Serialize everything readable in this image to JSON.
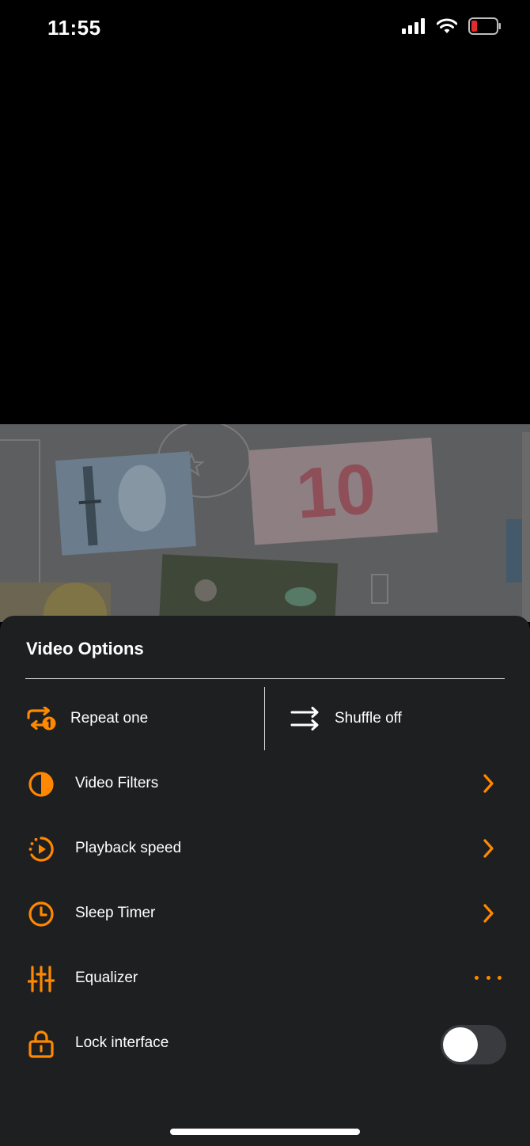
{
  "status_bar": {
    "time": "11:55",
    "icons": [
      "signal-icon",
      "wifi-icon",
      "battery-low-icon"
    ]
  },
  "colors": {
    "accent": "#ff8800",
    "sheet_bg": "#1e1f21",
    "battery_low": "#e32b2b"
  },
  "video": {
    "thumbnail_text": "10"
  },
  "sheet": {
    "title": "Video Options",
    "repeat": {
      "label": "Repeat one",
      "icon": "repeat-one-icon"
    },
    "shuffle": {
      "label": "Shuffle off",
      "icon": "shuffle-icon"
    },
    "items": [
      {
        "label": "Video Filters",
        "icon": "contrast-icon",
        "trailing": "chevron-right-icon"
      },
      {
        "label": "Playback speed",
        "icon": "playback-speed-icon",
        "trailing": "chevron-right-icon"
      },
      {
        "label": "Sleep Timer",
        "icon": "clock-icon",
        "trailing": "chevron-right-icon"
      },
      {
        "label": "Equalizer",
        "icon": "equalizer-icon",
        "trailing": "more-icon"
      },
      {
        "label": "Lock interface",
        "icon": "lock-icon",
        "trailing": "switch",
        "switch_on": false
      }
    ]
  }
}
